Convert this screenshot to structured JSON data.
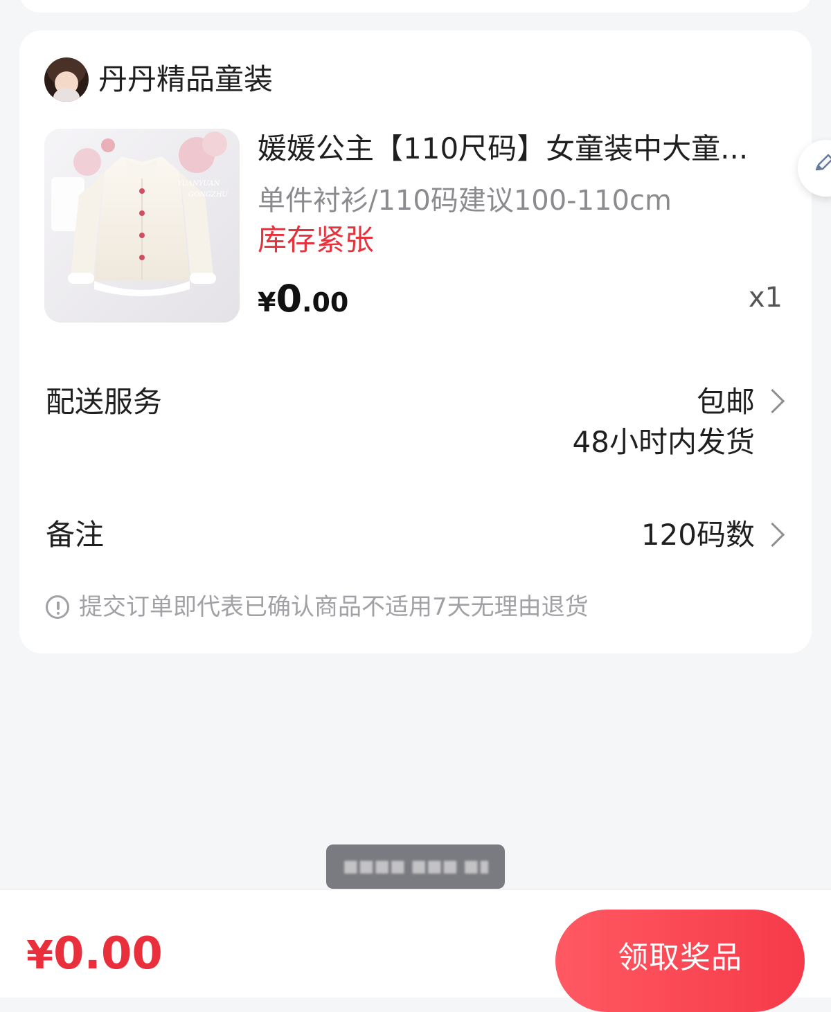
{
  "shop": {
    "name": "丹丹精品童装"
  },
  "product": {
    "title": "媛媛公主【110尺码】女童装中大童...",
    "spec": "单件衬衫/110码建议100-110cm",
    "stock_tag": "库存紧张",
    "price_currency": "¥",
    "price_integer": "0",
    "price_decimal": ".00",
    "quantity": "x1",
    "image_overlay_text_line1": "YUANYUAN",
    "image_overlay_text_line2": "GONGZHU"
  },
  "delivery": {
    "label": "配送服务",
    "value_line1": "包邮",
    "value_line2": "48小时内发货"
  },
  "remarks": {
    "label": "备注",
    "value": "120码数"
  },
  "notice": {
    "text": "提交订单即代表已确认商品不适用7天无理由退货"
  },
  "bottom": {
    "currency": "¥",
    "amount": "0.00",
    "button_label": "领取奖品"
  },
  "colors": {
    "accent_red": "#ea2f3c",
    "button_red": "#f63a49",
    "page_background": "#f5f6f8"
  },
  "icons": {
    "edit": "edit-icon",
    "chevron": "chevron-right-icon",
    "info": "info-icon"
  }
}
